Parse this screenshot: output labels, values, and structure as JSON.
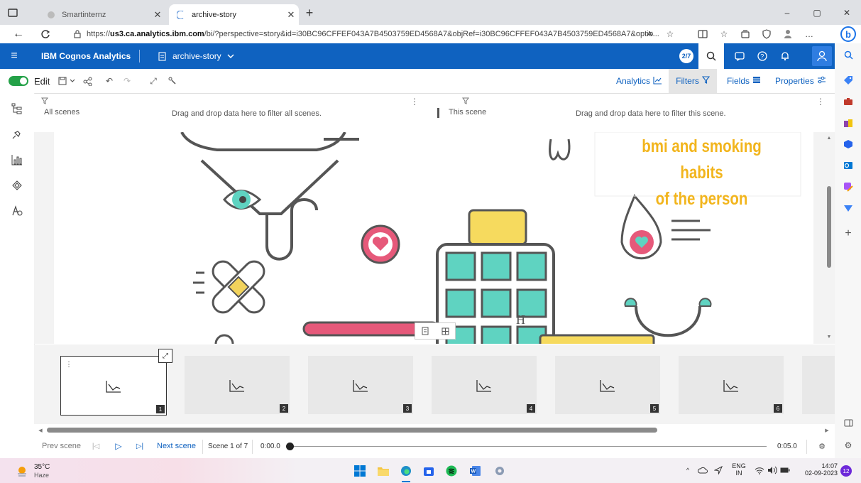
{
  "browser": {
    "tabs": [
      {
        "label": "Smartinternz"
      },
      {
        "label": "archive-story"
      }
    ],
    "new_tab": "+",
    "url_prefix": "https://",
    "url_domain": "us3.ca.analytics.ibm.com",
    "url_rest": "/bi/?perspective=story&id=i30BC96CFFEF043A7B4503759ED4568A7&objRef=i30BC96CFFEF043A7B4503759ED4568A7&optio...",
    "window_controls": {
      "minimize": "–",
      "restore": "▢",
      "close": "✕"
    }
  },
  "header": {
    "app_title": "IBM Cognos Analytics",
    "doc_title": "archive-story",
    "badge": "2/7"
  },
  "toolbar": {
    "edit_label": "Edit",
    "analytics_label": "Analytics",
    "filters_label": "Filters",
    "fields_label": "Fields",
    "properties_label": "Properties"
  },
  "filters": {
    "all_scenes_label": "All scenes",
    "all_scenes_hint": "Drag and drop data here to filter all scenes.",
    "this_scene_label": "This scene",
    "this_scene_hint": "Drag and drop data here to filter this scene."
  },
  "scene": {
    "heading_line1": "bmi and smoking habits",
    "heading_line2": "of the person",
    "hospital_letter": "H",
    "accent_color": "#f2b51d"
  },
  "thumbnails": [
    "1",
    "2",
    "3",
    "4",
    "5",
    "6"
  ],
  "playback": {
    "prev_label": "Prev scene",
    "next_label": "Next scene",
    "scene_counter": "Scene 1 of 7",
    "time_start": "0:00.0",
    "time_end": "0:05.0"
  },
  "taskbar": {
    "weather_temp": "35°C",
    "weather_desc": "Haze",
    "lang_line1": "ENG",
    "lang_line2": "IN",
    "time": "14:07",
    "date": "02-09-2023",
    "notif_count": "12"
  }
}
